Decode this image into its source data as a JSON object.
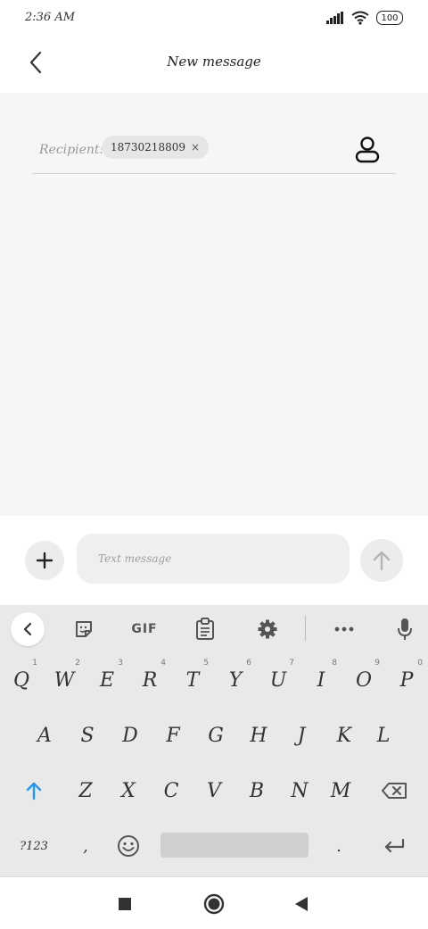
{
  "status": {
    "time": "2:36 AM",
    "battery": "100"
  },
  "header": {
    "title": "New message"
  },
  "recipient": {
    "label": "Recipient:",
    "chip": "18730218809",
    "chip_close": "×"
  },
  "compose": {
    "placeholder": "Text message"
  },
  "keyboard": {
    "toolbar": {
      "gif": "GIF"
    },
    "row1": [
      {
        "k": "Q",
        "h": "1"
      },
      {
        "k": "W",
        "h": "2"
      },
      {
        "k": "E",
        "h": "3"
      },
      {
        "k": "R",
        "h": "4"
      },
      {
        "k": "T",
        "h": "5"
      },
      {
        "k": "Y",
        "h": "6"
      },
      {
        "k": "U",
        "h": "7"
      },
      {
        "k": "I",
        "h": "8"
      },
      {
        "k": "O",
        "h": "9"
      },
      {
        "k": "P",
        "h": "0"
      }
    ],
    "row2": [
      "A",
      "S",
      "D",
      "F",
      "G",
      "H",
      "J",
      "K",
      "L"
    ],
    "row3": [
      "Z",
      "X",
      "C",
      "V",
      "B",
      "N",
      "M"
    ],
    "row4": {
      "symbols": "?123",
      "comma": ",",
      "period": "."
    }
  },
  "colors": {
    "accent": "#2196f3",
    "background": "#f6f6f6",
    "keyboard": "#e9e9e9"
  }
}
